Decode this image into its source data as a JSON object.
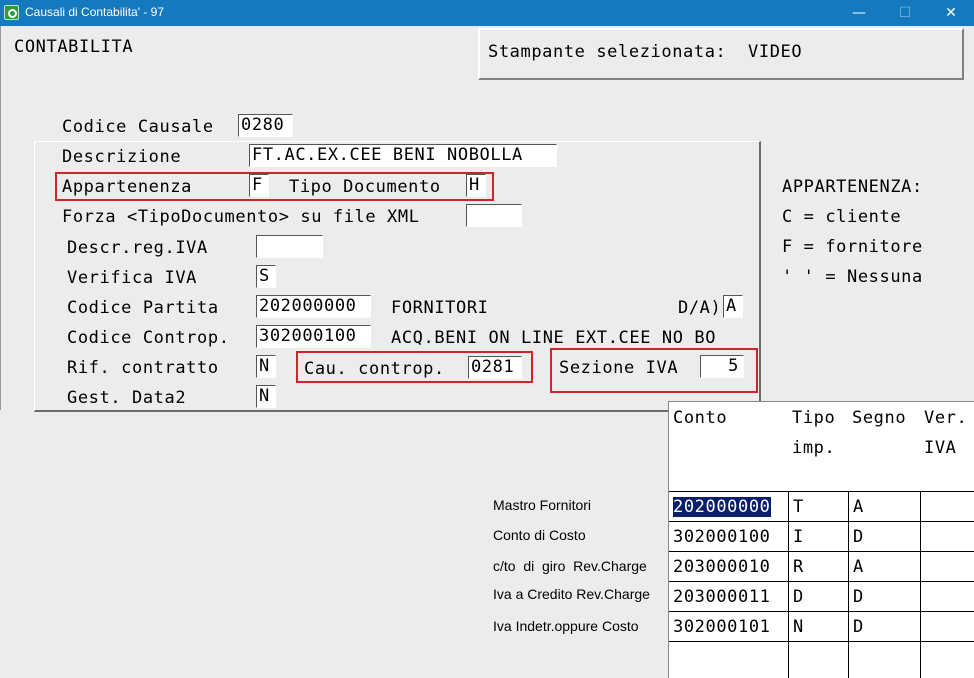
{
  "window": {
    "title": "Causali di Contabilita' - 97",
    "min_glyph": "—",
    "max_glyph": "☐",
    "close_glyph": "✕"
  },
  "header": {
    "module": "CONTABILITA",
    "printer": "Stampante selezionata:  VIDEO"
  },
  "form": {
    "codice_causale": {
      "label": "Codice Causale",
      "value": "0280"
    },
    "descrizione": {
      "label": "Descrizione",
      "value": "FT.AC.EX.CEE BENI NOBOLLA"
    },
    "appartenenza": {
      "label": "Appartenenza",
      "value": "F"
    },
    "tipo_documento": {
      "label": "Tipo Documento",
      "value": "H"
    },
    "forza_xml": {
      "label": "Forza <TipoDocumento> su file XML",
      "value": ""
    },
    "descr_reg_iva": {
      "label": "Descr.reg.IVA",
      "value": ""
    },
    "verifica_iva": {
      "label": "Verifica IVA",
      "value": "S"
    },
    "codice_partita": {
      "label": "Codice Partita",
      "value": "202000000",
      "desc": "FORNITORI",
      "da_label": "D/A)",
      "da_value": "A"
    },
    "codice_controp": {
      "label": "Codice Controp.",
      "value": "302000100",
      "desc": "ACQ.BENI ON LINE EXT.CEE NO BO"
    },
    "rif_contratto": {
      "label": "Rif. contratto",
      "value": "N"
    },
    "cau_controp": {
      "label": "Cau. controp.",
      "value": "0281"
    },
    "sezione_iva": {
      "label": "Sezione IVA",
      "value": "5"
    },
    "gest_data2": {
      "label": "Gest. Data2",
      "value": "N"
    }
  },
  "legend": {
    "title": "APPARTENENZA:",
    "items": [
      "C = cliente",
      "F = fornitore",
      "' ' = Nessuna"
    ]
  },
  "table": {
    "headers": {
      "conto": "Conto",
      "tipo": "Tipo",
      "imp": "imp.",
      "segno": "Segno",
      "ver": "Ver.",
      "iva": "IVA"
    },
    "rows": [
      {
        "label": "Mastro Fornitori",
        "conto": "202000000",
        "tipo": "T",
        "segno": "A",
        "ver": ""
      },
      {
        "label": "Conto di Costo",
        "conto": "302000100",
        "tipo": "I",
        "segno": "D",
        "ver": ""
      },
      {
        "label": "c/to  di  giro  Rev.Charge",
        "conto": "203000010",
        "tipo": "R",
        "segno": "A",
        "ver": ""
      },
      {
        "label": "Iva a Credito Rev.Charge",
        "conto": "203000011",
        "tipo": "D",
        "segno": "D",
        "ver": ""
      },
      {
        "label": "Iva Indetr.oppure Costo",
        "conto": "302000101",
        "tipo": "N",
        "segno": "D",
        "ver": ""
      },
      {
        "label": "",
        "conto": "",
        "tipo": "",
        "segno": "",
        "ver": ""
      }
    ]
  },
  "colors": {
    "titlebar": "#1479be",
    "background": "#ececec",
    "highlight": "#d2232a",
    "selection": "#0a1e6a"
  }
}
